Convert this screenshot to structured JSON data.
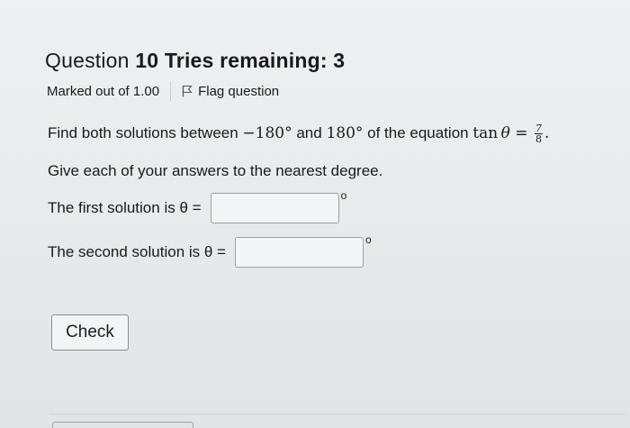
{
  "question": {
    "label": "Question",
    "number": "10",
    "tries_label": "Tries remaining: 3"
  },
  "meta": {
    "marked": "Marked out of 1.00",
    "flag_label": "Flag question"
  },
  "prompt": {
    "lead": "Find both solutions between ",
    "neg_angle": "−180°",
    "and": " and ",
    "pos_angle": "180°",
    "mid": " of the equation ",
    "func": "tan",
    "var": "θ",
    "eq": " = ",
    "frac_num": "7",
    "frac_den": "8",
    "end": "."
  },
  "instruction": "Give each of your answers to the nearest degree.",
  "answers": {
    "first_label": "The first solution is θ =",
    "first_value": "",
    "second_label": "The second solution is θ =",
    "second_value": "",
    "degree_symbol": "o"
  },
  "check_label": "Check"
}
